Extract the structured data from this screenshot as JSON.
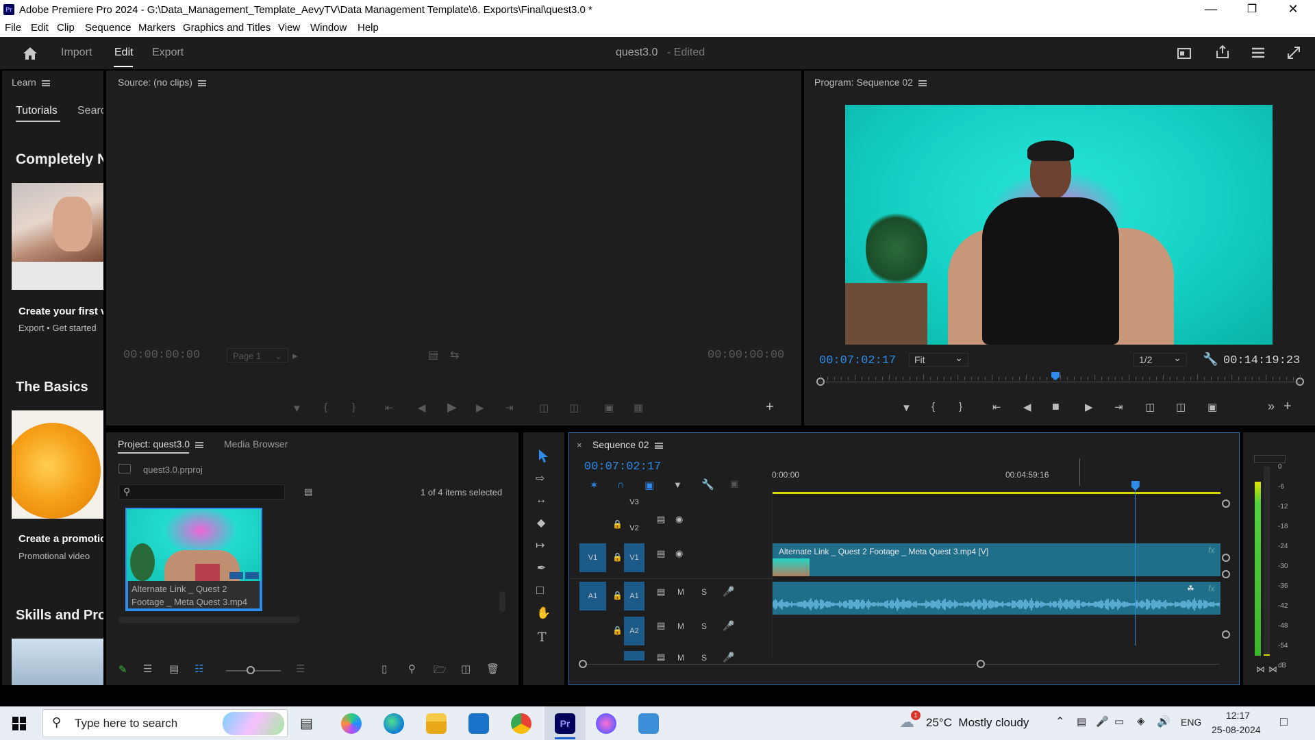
{
  "window": {
    "title": "Adobe Premiere Pro 2024 - G:\\Data_Management_Template_AevyTV\\Data Management Template\\6. Exports\\Final\\quest3.0 *",
    "logo": "Pr",
    "controls": [
      "minimize-icon",
      "restore-icon",
      "close-icon"
    ]
  },
  "menu": [
    "File",
    "Edit",
    "Clip",
    "Sequence",
    "Markers",
    "Graphics and Titles",
    "View",
    "Window",
    "Help"
  ],
  "header": {
    "tabs": [
      "Import",
      "Edit",
      "Export"
    ],
    "active_tab": "Edit",
    "project_name": "quest3.0",
    "project_status": "- Edited"
  },
  "learn": {
    "title": "Learn",
    "tabs": [
      "Tutorials",
      "Search"
    ],
    "sections": [
      {
        "heading": "Completely New",
        "card_title": "Create your first video",
        "card_sub": "Export • Get started"
      },
      {
        "heading": "The Basics",
        "card_title": "Create a promotional video",
        "card_sub": "Promotional video"
      },
      {
        "heading": "Skills and Projects"
      }
    ]
  },
  "source": {
    "title": "Source: (no clips)",
    "timecode_in": "00:00:00:00",
    "timecode_out": "00:00:00:00",
    "page": "Page 1"
  },
  "program": {
    "title": "Program: Sequence 02",
    "timecode": "00:07:02:17",
    "zoom": "Fit",
    "resolution": "1/2",
    "duration": "00:14:19:23",
    "playhead_fraction": 0.49
  },
  "project": {
    "tabs": [
      "Project: quest3.0",
      "Media Browser"
    ],
    "file": "quest3.0.prproj",
    "search_placeholder": "",
    "selection": "1 of 4 items selected",
    "clip_name": "Alternate Link _ Quest 2 Footage _ Meta Quest 3.mp4"
  },
  "timeline": {
    "title": "Sequence 02",
    "timecode": "00:07:02:17",
    "ruler": [
      "0:00:00",
      "00:04:59:16"
    ],
    "tracks": [
      {
        "id": "V3",
        "name": "V3"
      },
      {
        "id": "V2",
        "name": "V2"
      },
      {
        "id": "V1",
        "name": "V1",
        "src": "V1"
      },
      {
        "id": "A1",
        "name": "A1",
        "src": "A1",
        "m": "M",
        "s": "S"
      },
      {
        "id": "A2",
        "name": "A2",
        "m": "M",
        "s": "S"
      },
      {
        "id": "A3",
        "m": "M",
        "s": "S"
      }
    ],
    "video_clip": "Alternate Link _ Quest 2 Footage _ Meta Quest 3.mp4 [V]",
    "fx": "fx",
    "playhead_fraction": 0.81
  },
  "meter": {
    "scale": [
      "0",
      "-6",
      "-12",
      "-18",
      "-24",
      "-30",
      "-36",
      "-42",
      "-48",
      "-54",
      "dB"
    ]
  },
  "taskbar": {
    "search_placeholder": "Type here to search",
    "weather": "25°C  Mostly cloudy",
    "weather_badge": "1",
    "lang": "ENG",
    "time": "12:17",
    "date": "25-08-2024"
  },
  "colors": {
    "accent_blue": "#2d8ceb",
    "timecode_blue": "#2d8ceb",
    "clip_video": "#1f6f8b",
    "clip_audio": "#1f6f8b",
    "work_area_yellow": "#d8d800",
    "panel_bg": "#1b1b1b"
  }
}
